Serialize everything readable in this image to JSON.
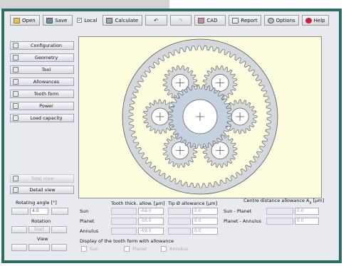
{
  "toolbar": {
    "open": "Open",
    "save": "Save",
    "local": "Local",
    "calculate": "Calculate",
    "cad": "CAD",
    "report": "Report",
    "options": "Options",
    "help": "Help"
  },
  "sidebar": {
    "items": [
      {
        "label": "Configuration",
        "icon": "configuration-icon"
      },
      {
        "label": "Geometry",
        "icon": "geometry-icon"
      },
      {
        "label": "Tool",
        "icon": "tool-icon"
      },
      {
        "label": "Allowances",
        "icon": "allowances-icon"
      },
      {
        "label": "Tooth form",
        "icon": "tooth-form-icon"
      },
      {
        "label": "Power",
        "icon": "power-icon"
      },
      {
        "label": "Load capacity",
        "icon": "load-capacity-icon"
      }
    ],
    "total_view": "Total view",
    "detail_view": "Detail view"
  },
  "controls": {
    "rotating_angle_label": "Rotating angle [°]",
    "rotating_angle_value": "4.0",
    "rotation_label": "Rotation",
    "start": "Start",
    "view_label": "View"
  },
  "allowance": {
    "tooth_thick_header": "Tooth thick. allow. [µm]",
    "tip_header": "Tip Ø allowance [µm]",
    "centre_header": "Centre distance allowance A",
    "centre_header_sub": "a",
    "centre_header_unit": " [µm]",
    "rows": [
      {
        "name": "Sun",
        "tooth": "-69.0",
        "tip": "0.0"
      },
      {
        "name": "Planet",
        "tooth": "-50.0",
        "tip": "0.0"
      },
      {
        "name": "Annulus",
        "tooth": "-69.0",
        "tip": "0.0"
      }
    ],
    "centre_rows": [
      {
        "name": "Sun - Planet",
        "value": "0.0"
      },
      {
        "name": "Planet - Annulus",
        "value": "0.0"
      }
    ],
    "display_label": "Display of the tooth form with allowance",
    "checkboxes": [
      "Sun",
      "Planet",
      "Annulus"
    ]
  },
  "colors": {
    "frame": "#2a6e62",
    "gear_fill": "#d3d8dd",
    "sun_fill": "#c5d1e0",
    "canvas_bg": "#fffddf"
  }
}
